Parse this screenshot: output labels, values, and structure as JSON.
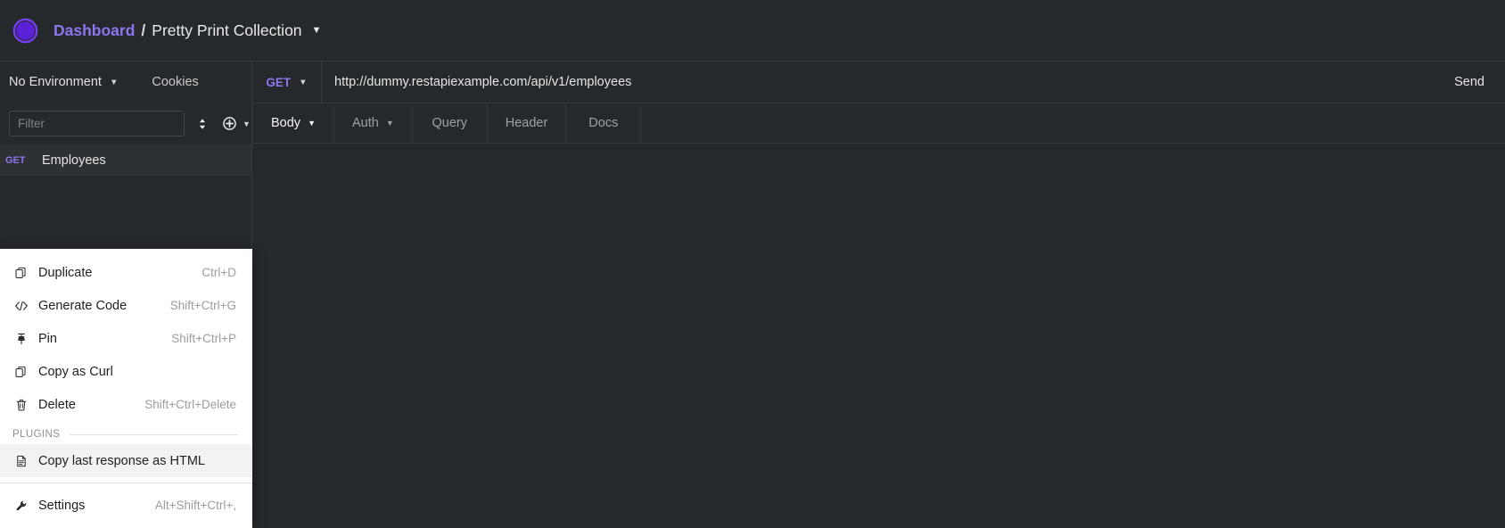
{
  "header": {
    "logo_icon": "insomnia-logo-icon",
    "breadcrumb": {
      "root": "Dashboard",
      "separator": "/",
      "current": "Pretty Print Collection",
      "caret_icon": "chevron-down-icon"
    }
  },
  "sidebar": {
    "environment": {
      "label": "No Environment",
      "caret_icon": "chevron-down-icon"
    },
    "cookies_label": "Cookies",
    "filter": {
      "placeholder": "Filter",
      "value": ""
    },
    "sort_icon": "sort-updown-icon",
    "add_icon": "plus-circle-icon",
    "add_caret_icon": "chevron-down-icon",
    "requests": [
      {
        "method": "GET",
        "name": "Employees"
      }
    ]
  },
  "context_menu": {
    "items": [
      {
        "icon": "duplicate-icon",
        "label": "Duplicate",
        "shortcut": "Ctrl+D",
        "highlighted": false
      },
      {
        "icon": "code-icon",
        "label": "Generate Code",
        "shortcut": "Shift+Ctrl+G",
        "highlighted": false
      },
      {
        "icon": "pin-icon",
        "label": "Pin",
        "shortcut": "Shift+Ctrl+P",
        "highlighted": false
      },
      {
        "icon": "copy-icon",
        "label": "Copy as Curl",
        "shortcut": "",
        "highlighted": false
      },
      {
        "icon": "trash-icon",
        "label": "Delete",
        "shortcut": "Shift+Ctrl+Delete",
        "highlighted": false
      }
    ],
    "section_label": "PLUGINS",
    "plugin_items": [
      {
        "icon": "document-icon",
        "label": "Copy last response as HTML",
        "shortcut": "",
        "highlighted": true
      }
    ],
    "footer_items": [
      {
        "icon": "wrench-icon",
        "label": "Settings",
        "shortcut": "Alt+Shift+Ctrl+,",
        "highlighted": false
      }
    ]
  },
  "request": {
    "method": "GET",
    "method_caret_icon": "chevron-down-icon",
    "url": "http://dummy.restapiexample.com/api/v1/employees",
    "send_label": "Send",
    "tabs": [
      {
        "label": "Body",
        "active": true,
        "caret": true
      },
      {
        "label": "Auth",
        "active": false,
        "caret": true
      },
      {
        "label": "Query",
        "active": false,
        "caret": false
      },
      {
        "label": "Header",
        "active": false,
        "caret": false
      },
      {
        "label": "Docs",
        "active": false,
        "caret": false
      }
    ]
  },
  "colors": {
    "accent_purple": "#8b76ef",
    "background": "#26292c",
    "panel": "#2e3134",
    "menu_background": "#ffffff",
    "menu_highlight": "#f2f2f2"
  }
}
